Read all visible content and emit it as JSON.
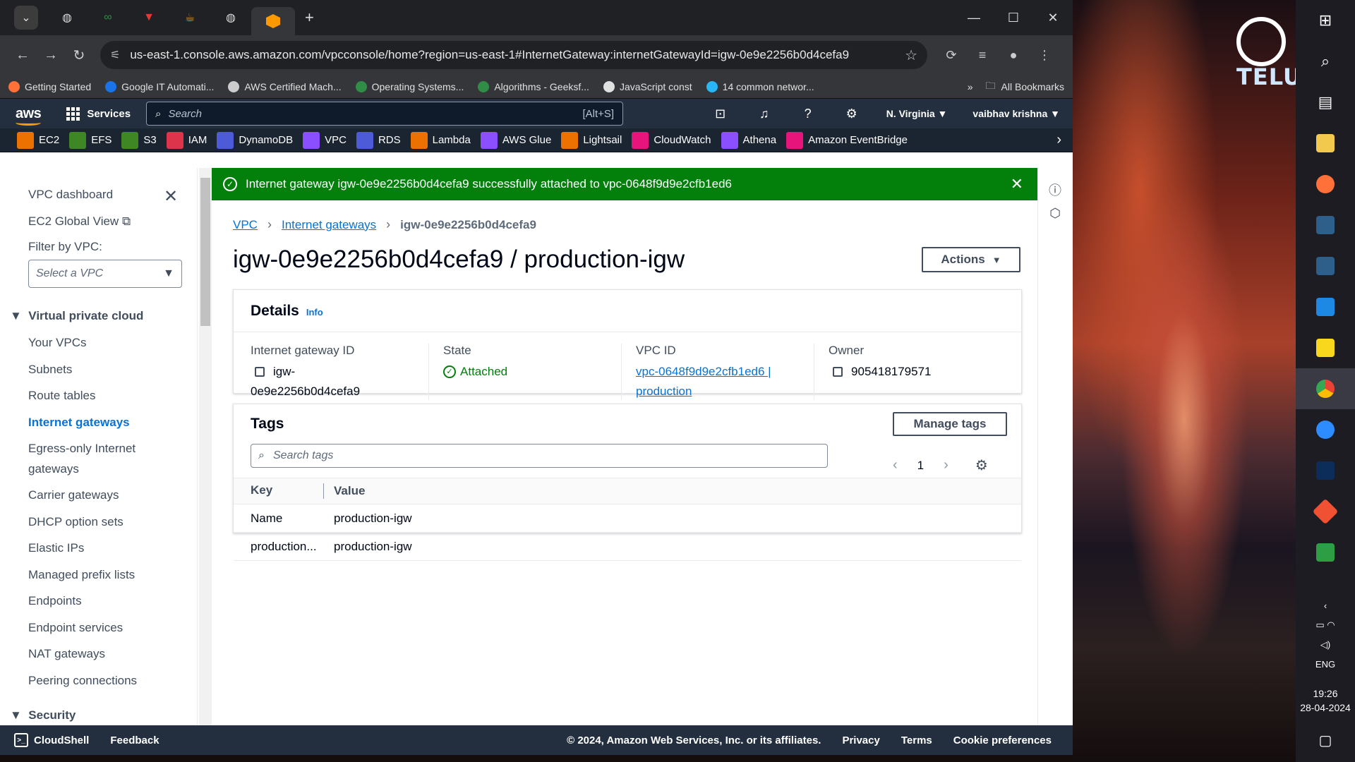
{
  "browser": {
    "url": "us-east-1.console.aws.amazon.com/vpcconsole/home?region=us-east-1#InternetGateway:internetGatewayId=igw-0e9e2256b0d4cefa9",
    "bookmarks": [
      {
        "label": "Getting Started",
        "color": "#ff7139"
      },
      {
        "label": "Google IT Automati...",
        "color": "#1a73e8"
      },
      {
        "label": "AWS Certified Mach...",
        "color": "#cccccc"
      },
      {
        "label": "Operating Systems...",
        "color": "#2f8d46"
      },
      {
        "label": "Algorithms - Geeksf...",
        "color": "#2f8d46"
      },
      {
        "label": "JavaScript const",
        "color": "#e0e0e0"
      },
      {
        "label": "14 common networ...",
        "color": "#29b6f6"
      }
    ],
    "all_bookmarks": "All Bookmarks",
    "more_chevron": "»"
  },
  "aws": {
    "logo": "aws",
    "services": "Services",
    "search_placeholder": "Search",
    "search_shortcut": "[Alt+S]",
    "region": "N. Virginia ▼",
    "user": "vaibhav krishna ▼",
    "favorites": [
      {
        "label": "EC2",
        "color": "#ed7100"
      },
      {
        "label": "EFS",
        "color": "#3f8624"
      },
      {
        "label": "S3",
        "color": "#3f8624"
      },
      {
        "label": "IAM",
        "color": "#dd344c"
      },
      {
        "label": "DynamoDB",
        "color": "#4d5bd9"
      },
      {
        "label": "VPC",
        "color": "#8c4fff"
      },
      {
        "label": "RDS",
        "color": "#4d5bd9"
      },
      {
        "label": "Lambda",
        "color": "#ed7100"
      },
      {
        "label": "AWS Glue",
        "color": "#8c4fff"
      },
      {
        "label": "Lightsail",
        "color": "#ed7100"
      },
      {
        "label": "CloudWatch",
        "color": "#e7157b"
      },
      {
        "label": "Athena",
        "color": "#8c4fff"
      },
      {
        "label": "Amazon EventBridge",
        "color": "#e7157b"
      }
    ]
  },
  "sidebar": {
    "dashboard": "VPC dashboard",
    "ec2_global": "EC2 Global View",
    "filter_label": "Filter by VPC:",
    "filter_placeholder": "Select a VPC",
    "section_vpc": "Virtual private cloud",
    "items": [
      "Your VPCs",
      "Subnets",
      "Route tables",
      "Internet gateways",
      "Egress-only Internet",
      "gateways",
      "Carrier gateways",
      "DHCP option sets",
      "Elastic IPs",
      "Managed prefix lists",
      "Endpoints",
      "Endpoint services",
      "NAT gateways",
      "Peering connections"
    ],
    "section_security": "Security"
  },
  "flash": {
    "message": "Internet gateway igw-0e9e2256b0d4cefa9 successfully attached to vpc-0648f9d9e2cfb1ed6"
  },
  "breadcrumb": {
    "root": "VPC",
    "parent": "Internet gateways",
    "current": "igw-0e9e2256b0d4cefa9"
  },
  "page": {
    "title": "igw-0e9e2256b0d4cefa9 / production-igw",
    "actions": "Actions"
  },
  "details": {
    "heading": "Details",
    "info": "Info",
    "igw_label": "Internet gateway ID",
    "igw_value_1": "igw-",
    "igw_value_2": "0e9e2256b0d4cefa9",
    "state_label": "State",
    "state_value": "Attached",
    "vpc_label": "VPC ID",
    "vpc_value_1": "vpc-0648f9d9e2cfb1ed6 |",
    "vpc_value_2": "production",
    "owner_label": "Owner",
    "owner_value": "905418179571"
  },
  "tags": {
    "heading": "Tags",
    "manage": "Manage tags",
    "search_placeholder": "Search tags",
    "page": "1",
    "col_key": "Key",
    "col_value": "Value",
    "rows": [
      {
        "key": "Name",
        "value": "production-igw"
      },
      {
        "key": "production...",
        "value": "production-igw"
      }
    ]
  },
  "footer": {
    "cloudshell": "CloudShell",
    "feedback": "Feedback",
    "copyright": "© 2024, Amazon Web Services, Inc. or its affiliates.",
    "privacy": "Privacy",
    "terms": "Terms",
    "cookie": "Cookie preferences"
  },
  "desktop": {
    "logo_text": "TELU",
    "lang": "ENG",
    "time": "19:26",
    "date": "28-04-2024"
  }
}
